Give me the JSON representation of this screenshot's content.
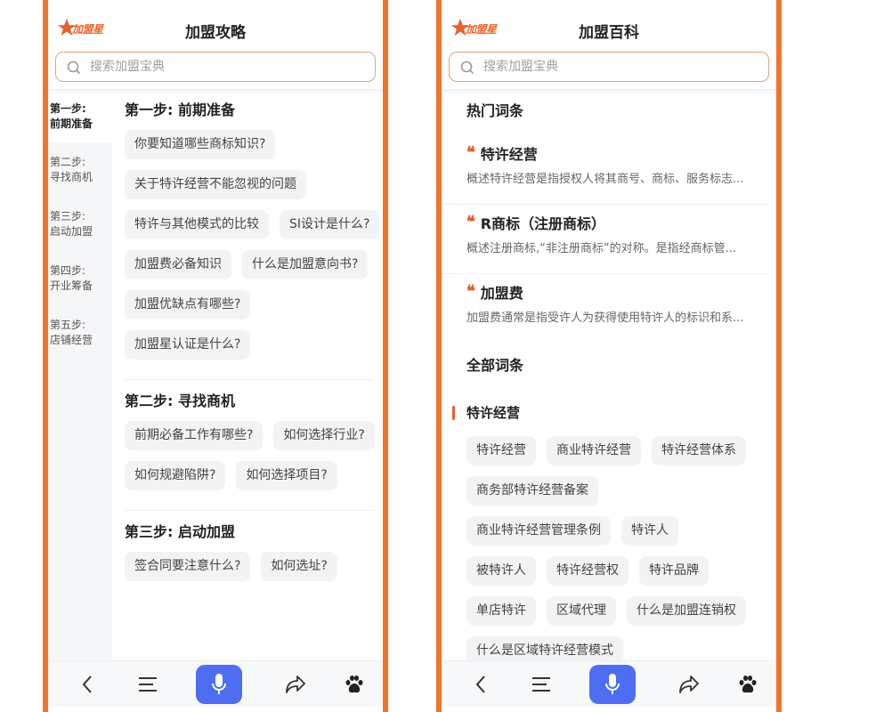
{
  "left": {
    "logo_text": "加盟星",
    "title": "加盟攻略",
    "search_placeholder": "搜索加盟宝典",
    "steps_nav": [
      {
        "line1": "第一步:",
        "line2": "前期准备"
      },
      {
        "line1": "第二步:",
        "line2": "寻找商机"
      },
      {
        "line1": "第三步:",
        "line2": "启动加盟"
      },
      {
        "line1": "第四步:",
        "line2": "开业筹备"
      },
      {
        "line1": "第五步:",
        "line2": "店铺经营"
      }
    ],
    "sections": [
      {
        "title": "第一步: 前期准备",
        "questions": [
          "你要知道哪些商标知识?",
          "关于特许经营不能忽视的问题",
          "特许与其他模式的比较",
          "SI设计是什么?",
          "加盟费必备知识",
          "什么是加盟意向书?",
          "加盟优缺点有哪些?",
          "加盟星认证是什么?"
        ]
      },
      {
        "title": "第二步: 寻找商机",
        "questions": [
          "前期必备工作有哪些?",
          "如何选择行业?",
          "如何规避陷阱?",
          "如何选择项目?"
        ]
      },
      {
        "title": "第三步: 启动加盟",
        "questions": [
          "签合同要注意什么?",
          "如何选址?"
        ]
      }
    ]
  },
  "right": {
    "logo_text": "加盟星",
    "title": "加盟百科",
    "search_placeholder": "搜索加盟宝典",
    "hot_heading": "热门词条",
    "hot_entries": [
      {
        "title": "特许经营",
        "desc": "概述特许经营是指授权人将其商号、商标、服务标志..."
      },
      {
        "title": "R商标（注册商标）",
        "desc": "概述注册商标,“非注册商标”的对称。是指经商标管..."
      },
      {
        "title": "加盟费",
        "desc": "加盟费通常是指受许人为获得使用特许人的标识和系..."
      }
    ],
    "all_heading": "全部词条",
    "category": "特许经营",
    "terms": [
      "特许经营",
      "商业特许经营",
      "特许经营体系",
      "商务部特许经营备案",
      "商业特许经营管理条例",
      "特许人",
      "被特许人",
      "特许经营权",
      "特许品牌",
      "单店特许",
      "区域代理",
      "什么是加盟连销权",
      "什么是区域特许经营模式"
    ]
  },
  "colors": {
    "accent": "#e8612a",
    "frame": "#f0742a",
    "voice_button": "#4e6ef2"
  },
  "icons": [
    "star-logo-icon",
    "search-icon",
    "back-arrow-icon",
    "menu-icon",
    "microphone-icon",
    "share-icon",
    "paw-icon"
  ]
}
